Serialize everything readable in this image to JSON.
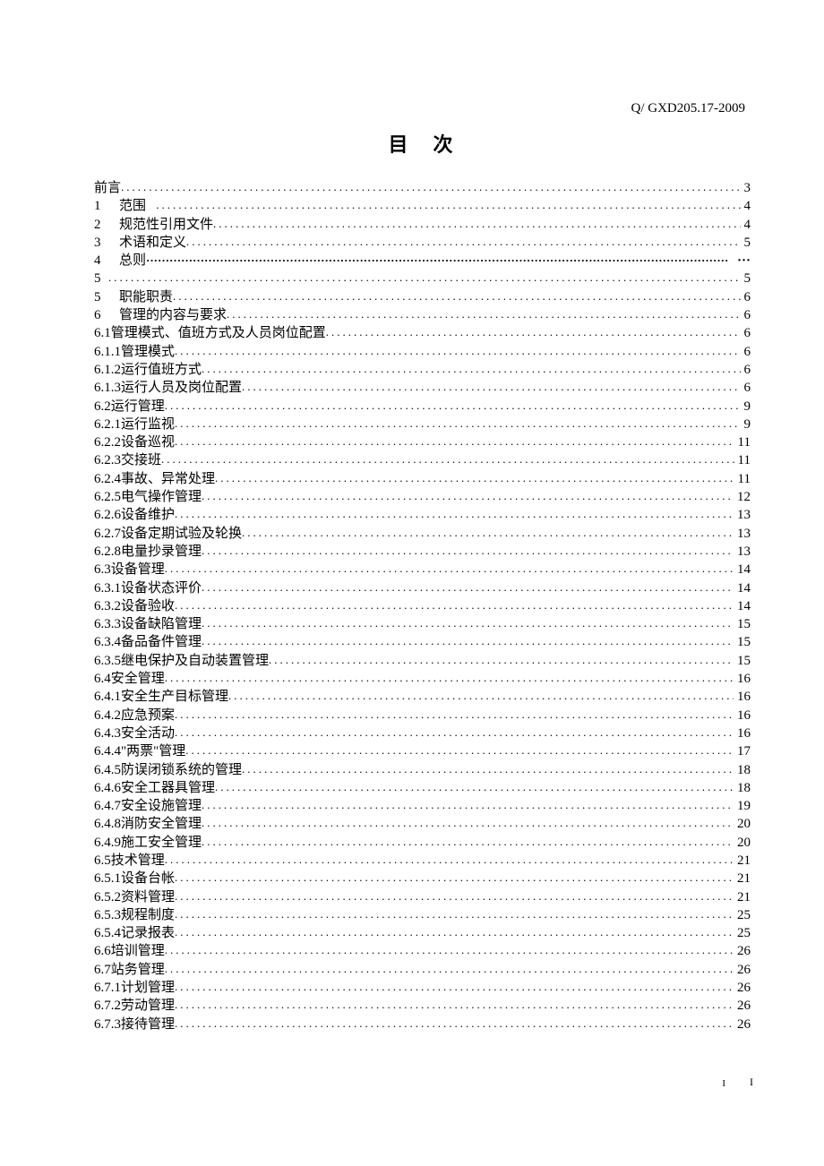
{
  "doc_id": "Q/ GXD205.17-2009",
  "title": "目次",
  "footer_page_label_outer": "I",
  "footer_page_label_inner": "I",
  "toc": [
    {
      "num": "",
      "text": "前言",
      "page": "3"
    },
    {
      "num": "1",
      "text": "范围",
      "page": "4"
    },
    {
      "num": "2",
      "text": "规范性引用文件",
      "page": "4"
    },
    {
      "num": "3",
      "text": "术语和定义",
      "page": "5"
    },
    {
      "num": "4",
      "text": "总则",
      "page": ""
    },
    {
      "num": "5",
      "text": "",
      "page": "5"
    },
    {
      "num": "5",
      "text": "职能职责",
      "page": "6"
    },
    {
      "num": "6",
      "text": "管理的内容与要求",
      "page": "6"
    },
    {
      "num": "6.1",
      "text": "管理模式、值班方式及人员岗位配置",
      "page": "6"
    },
    {
      "num": "6.1.1",
      "text": "管理模式",
      "page": "6"
    },
    {
      "num": "6.1.2",
      "text": "运行值班方式",
      "page": "6"
    },
    {
      "num": "6.1.3",
      "text": "运行人员及岗位配置",
      "page": "6"
    },
    {
      "num": "6.2",
      "text": "运行管理",
      "page": "9"
    },
    {
      "num": "6.2.1",
      "text": "运行监视",
      "page": "9"
    },
    {
      "num": "6.2.2",
      "text": "设备巡视",
      "page": "11"
    },
    {
      "num": "6.2.3",
      "text": "交接班",
      "page": "11"
    },
    {
      "num": "6.2.4",
      "text": "事故、异常处理",
      "page": "11"
    },
    {
      "num": "6.2.5",
      "text": "电气操作管理",
      "page": "12"
    },
    {
      "num": "6.2.6",
      "text": "设备维护",
      "page": "13"
    },
    {
      "num": "6.2.7",
      "text": "设备定期试验及轮换",
      "page": "13"
    },
    {
      "num": "6.2.8",
      "text": "电量抄录管理",
      "page": "13"
    },
    {
      "num": "6.3",
      "text": "设备管理",
      "page": "14"
    },
    {
      "num": "6.3.1",
      "text": "设备状态评价",
      "page": "14"
    },
    {
      "num": "6.3.2",
      "text": "设备验收",
      "page": "14"
    },
    {
      "num": "6.3.3",
      "text": "设备缺陷管理",
      "page": "15"
    },
    {
      "num": "6.3.4",
      "text": "备品备件管理",
      "page": "15"
    },
    {
      "num": "6.3.5",
      "text": "继电保护及自动装置管理",
      "page": "15"
    },
    {
      "num": "6.4",
      "text": "安全管理",
      "page": "16"
    },
    {
      "num": "6.4.1",
      "text": "安全生产目标管理",
      "page": "16"
    },
    {
      "num": "6.4.2",
      "text": "应急预案",
      "page": "16"
    },
    {
      "num": "6.4.3",
      "text": "安全活动",
      "page": "16"
    },
    {
      "num": "6.4.4",
      "text": "\"两票\"管理",
      "page": "17"
    },
    {
      "num": "6.4.5",
      "text": "防误闭锁系统的管理",
      "page": "18"
    },
    {
      "num": "6.4.6",
      "text": "安全工器具管理",
      "page": "18"
    },
    {
      "num": "6.4.7",
      "text": "安全设施管理",
      "page": "19"
    },
    {
      "num": "6.4.8",
      "text": "消防安全管理",
      "page": "20"
    },
    {
      "num": "6.4.9",
      "text": "施工安全管理",
      "page": "20"
    },
    {
      "num": "6.5",
      "text": "技术管理",
      "page": "21"
    },
    {
      "num": "6.5.1",
      "text": "设备台帐",
      "page": "21"
    },
    {
      "num": "6.5.2",
      "text": "资料管理",
      "page": "21"
    },
    {
      "num": "6.5.3",
      "text": "规程制度",
      "page": "25"
    },
    {
      "num": "6.5.4",
      "text": "记录报表",
      "page": "25"
    },
    {
      "num": "6.6",
      "text": "培训管理",
      "page": "26"
    },
    {
      "num": "6.7",
      "text": "站务管理",
      "page": "26"
    },
    {
      "num": "6.7.1",
      "text": "计划管理",
      "page": "26"
    },
    {
      "num": "6.7.2",
      "text": "劳动管理",
      "page": "26"
    },
    {
      "num": "6.7.3",
      "text": "接待管理",
      "page": "26"
    }
  ]
}
